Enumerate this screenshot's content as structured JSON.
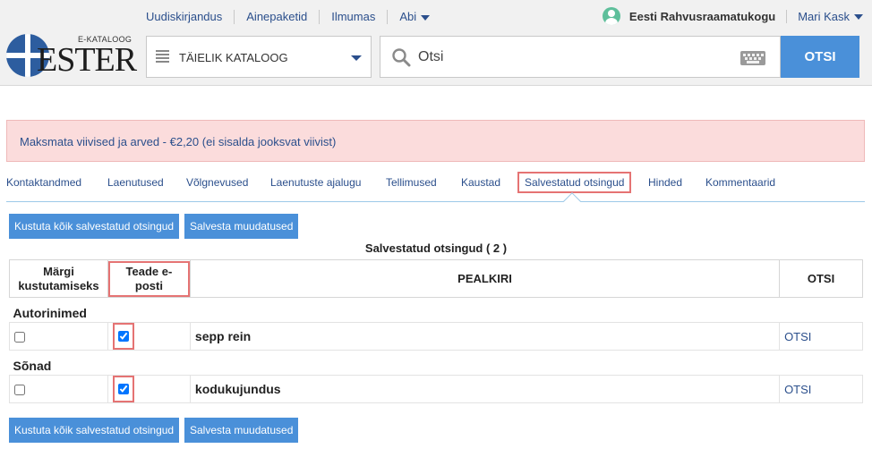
{
  "topnav": {
    "links": [
      "Uudiskirjandus",
      "Ainepaketid",
      "Ilmumas",
      "Abi"
    ]
  },
  "user": {
    "library": "Eesti Rahvusraamatukogu",
    "name": "Mari Kask"
  },
  "logo": {
    "subtitle": "E-KATALOOG",
    "title": "ESTER"
  },
  "search": {
    "catalog": "TÄIELIK KATALOOG",
    "placeholder": "Otsi",
    "button": "OTSI"
  },
  "alert": {
    "text": "Maksmata viivised ja arved - €2,20 (ei sisalda jooksvat viivist)"
  },
  "tabs": [
    "Kontaktandmed",
    "Laenutused",
    "Võlgnevused",
    "Laenutuste ajalugu",
    "Tellimused",
    "Kaustad",
    "Salvestatud otsingud",
    "Hinded",
    "Kommentaarid"
  ],
  "actions": {
    "delete_all": "Kustuta kõik salvestatud otsingud",
    "save_changes": "Salvesta muudatused"
  },
  "table": {
    "title": "Salvestatud otsingud ( 2 )",
    "headers": {
      "mark_delete": "Märgi kustutamiseks",
      "email_notify": "Teade e-posti",
      "title": "PEALKIRI",
      "search": "OTSI"
    },
    "groups": [
      {
        "name": "Autorinimed",
        "rows": [
          {
            "title": "sepp rein",
            "link": "OTSI"
          }
        ]
      },
      {
        "name": "Sõnad",
        "rows": [
          {
            "title": "kodukujundus",
            "link": "OTSI"
          }
        ]
      }
    ]
  },
  "colors": {
    "accent": "#4a90d9",
    "link": "#2b4f8c",
    "alert_bg": "#fbdcdc",
    "highlight": "#e57373"
  }
}
